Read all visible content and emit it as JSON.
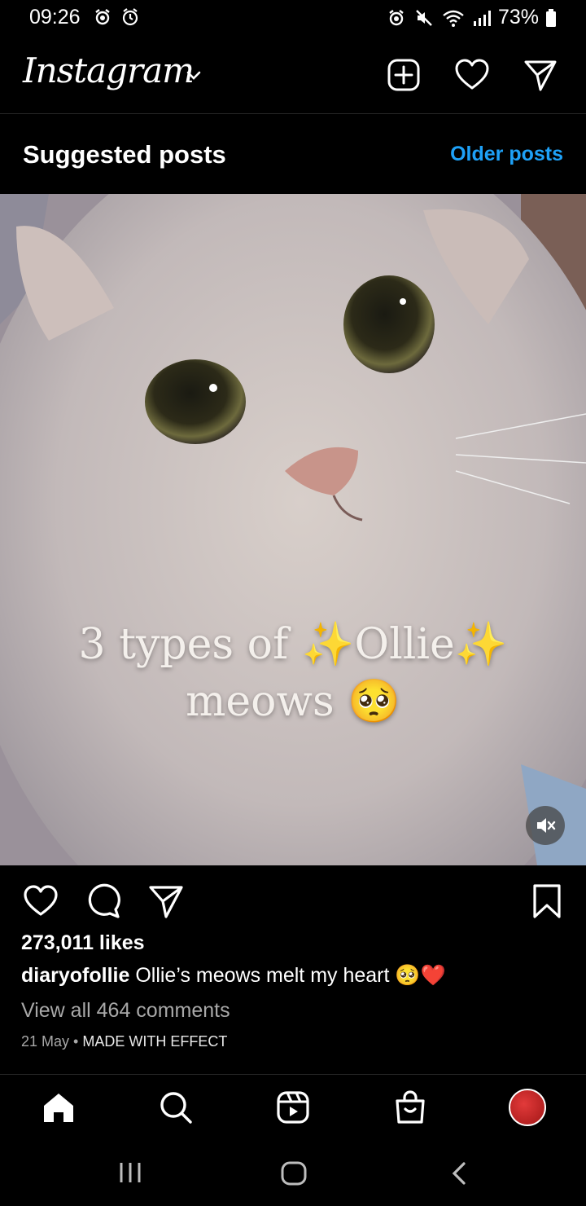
{
  "status_bar": {
    "time": "09:26",
    "battery": "73%",
    "icons": [
      "alarm-icon",
      "clock-icon",
      "alarm-icon",
      "mute-icon",
      "wifi-icon",
      "signal-icon",
      "battery-icon"
    ]
  },
  "header": {
    "logo_text": "Instagram",
    "icons": [
      "chevron-down-icon",
      "new-post-icon",
      "heart-icon",
      "direct-message-icon"
    ]
  },
  "suggested": {
    "title": "Suggested posts",
    "older_link": "Older posts"
  },
  "post": {
    "overlay_line1": "3 types of ✨Ollie✨",
    "overlay_line2": "meows 🥺",
    "likes": "273,011 likes",
    "username": "diaryofollie",
    "caption": "Ollie’s meows melt my heart 🥺❤️",
    "view_comments": "View all 464 comments",
    "date": "21 May",
    "separator": "•",
    "effect_label": "MADE WITH EFFECT"
  },
  "bottom_nav": {
    "items": [
      "home-icon",
      "search-icon",
      "reels-icon",
      "shop-icon",
      "profile-avatar"
    ]
  },
  "system_nav": {
    "items": [
      "recent-apps-icon",
      "home-button-icon",
      "back-icon"
    ]
  }
}
